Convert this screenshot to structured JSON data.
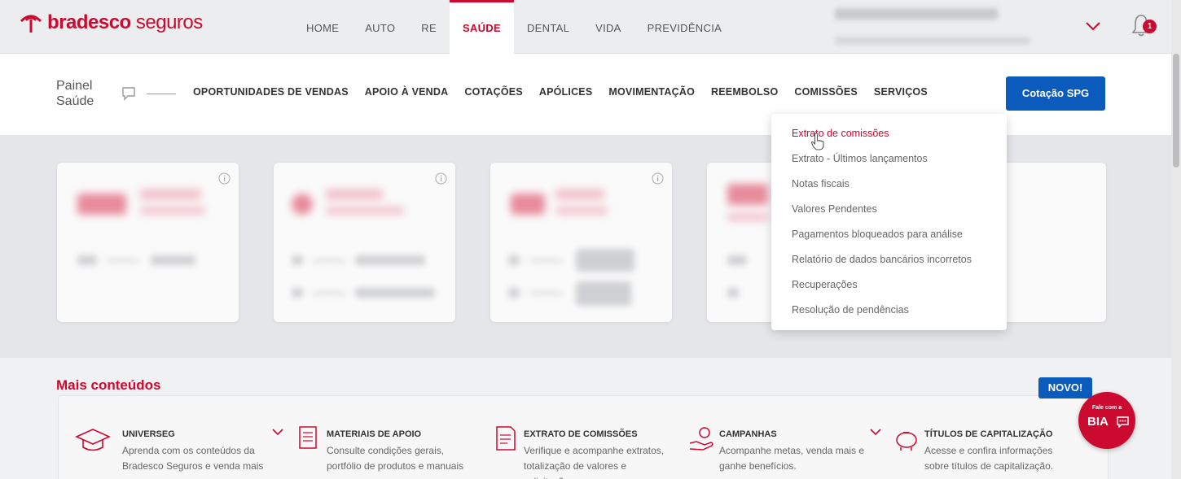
{
  "brand": {
    "name_bold": "bradesco",
    "name_light": " seguros",
    "color": "#cc092f"
  },
  "main_nav": [
    {
      "label": "HOME"
    },
    {
      "label": "AUTO"
    },
    {
      "label": "RE"
    },
    {
      "label": "SAÚDE",
      "active": true
    },
    {
      "label": "DENTAL"
    },
    {
      "label": "VIDA"
    },
    {
      "label": "PREVIDÊNCIA"
    }
  ],
  "notifications": {
    "count": "1"
  },
  "subheader": {
    "title_line1": "Painel",
    "title_line2": "Saúde",
    "nav": [
      {
        "label": "OPORTUNIDADES DE VENDAS"
      },
      {
        "label": "APOIO À VENDA"
      },
      {
        "label": "COTAÇÕES"
      },
      {
        "label": "APÓLICES"
      },
      {
        "label": "MOVIMENTAÇÃO"
      },
      {
        "label": "REEMBOLSO"
      },
      {
        "label": "COMISSÕES"
      },
      {
        "label": "SERVIÇOS"
      }
    ],
    "cta_label": "Cotação SPG",
    "cta_color": "#0b5bbd"
  },
  "commissions_menu": [
    {
      "label": "Extrato de comissões"
    },
    {
      "label": "Extrato - Últimos lançamentos"
    },
    {
      "label": "Notas fiscais"
    },
    {
      "label": "Valores Pendentes"
    },
    {
      "label": "Pagamentos bloqueados para análise"
    },
    {
      "label": "Relatório de dados bancários incorretos"
    },
    {
      "label": "Recuperações"
    },
    {
      "label": "Resolução de pendências"
    }
  ],
  "more_content": {
    "title": "Mais conteúdos",
    "badge": "NOVO!",
    "items": [
      {
        "title": "UNIVERSEG",
        "desc": "Aprenda com os conteúdos da Bradesco Seguros e venda mais"
      },
      {
        "title": "MATERIAIS DE APOIO",
        "desc": "Consulte condições gerais, portfólio de produtos e manuais"
      },
      {
        "title": "EXTRATO DE COMISSÕES",
        "desc": "Verifique e acompanhe extratos, totalização de valores e solicitações"
      },
      {
        "title": "CAMPANHAS",
        "desc": "Acompanhe metas, venda mais e ganhe benefícios."
      },
      {
        "title": "TÍTULOS DE CAPITALIZAÇÃO",
        "desc": "Acesse e confira informações sobre títulos de capitalização."
      }
    ]
  },
  "assistant": {
    "small": "Fale com a",
    "big": "BIA"
  }
}
